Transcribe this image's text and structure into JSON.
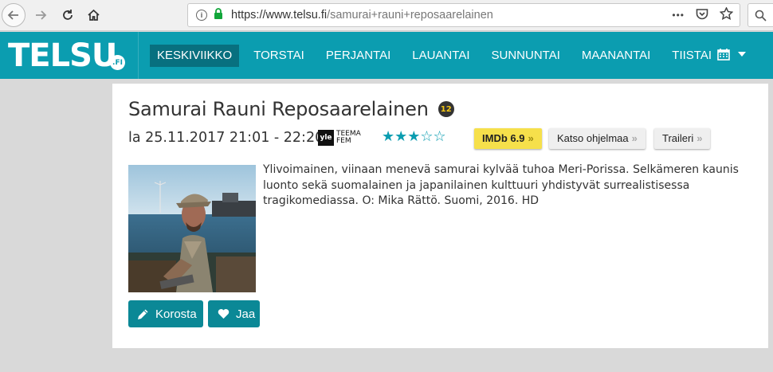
{
  "browser": {
    "url_host": "https://www.telsu.fi",
    "url_path": "/samurai+rauni+reposaarelainen",
    "more_label": "•••"
  },
  "site": {
    "logo": "TELSU",
    "logo_suffix": ".FI",
    "accent_color": "#0b9db0",
    "days": [
      {
        "label": "KESKIVIIKKO",
        "active": true
      },
      {
        "label": "TORSTAI"
      },
      {
        "label": "PERJANTAI"
      },
      {
        "label": "LAUANTAI"
      },
      {
        "label": "SUNNUNTAI"
      },
      {
        "label": "MAANANTAI"
      },
      {
        "label": "TIISTAI"
      }
    ]
  },
  "program": {
    "title": "Samurai Rauni Reposaarelainen",
    "age_rating": "12",
    "airtime": "la 25.11.2017 21:01 - 22:20",
    "channel_logo": "yle",
    "channel_name": "TEEMA FEM",
    "rating_stars": 3,
    "rating_max": 5,
    "stars_text": "★★★☆☆",
    "imdb_label": "IMDb 6.9",
    "watch_label": "Katso ohjelmaa",
    "trailer_label": "Traileri",
    "description": "Ylivoimainen, viinaan menevä samurai kylvää tuhoa Meri-Porissa. Selkämeren kaunis luonto sekä suomalainen ja japanilainen kulttuuri yhdistyvät surrealistisessa tragikomediassa. O: Mika Rättö. Suomi, 2016. HD",
    "highlight_label": "Korosta",
    "share_label": "Jaa"
  }
}
